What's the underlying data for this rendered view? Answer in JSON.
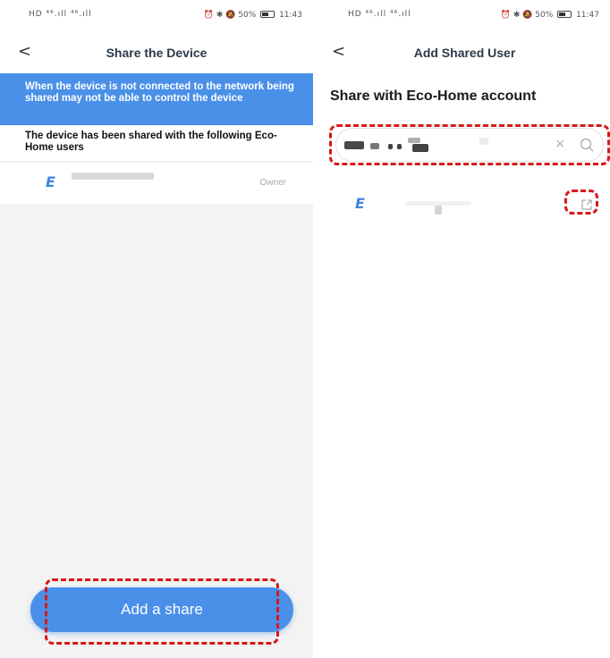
{
  "left": {
    "status": {
      "signal": "HD ⁴⁶.ıll ⁴⁶.ıll",
      "icons": "⏰ ✱ 🔕 50%",
      "time": "11:43"
    },
    "nav": {
      "back": "<",
      "title": "Share the Device"
    },
    "notice": "When the device is not connected to the network being shared may not be able to control the device",
    "shared_title": "The device has been shared with the following Eco-Home users",
    "user": {
      "logo": "E",
      "name": "",
      "role": "Owner"
    },
    "add_button": "Add a share"
  },
  "right": {
    "status": {
      "signal": "HD ⁴⁶.ıll ⁴⁶.ıll",
      "icons": "⏰ ✱ 🔕 50%",
      "time": "11:47"
    },
    "nav": {
      "back": "<",
      "title": "Add Shared User"
    },
    "account_title": "Share with Eco-Home account",
    "search": {
      "value": "",
      "clear": "×"
    },
    "result": {
      "logo": "E",
      "name": ""
    }
  },
  "colors": {
    "accent": "#4a90e8",
    "highlight": "#d8171a"
  }
}
